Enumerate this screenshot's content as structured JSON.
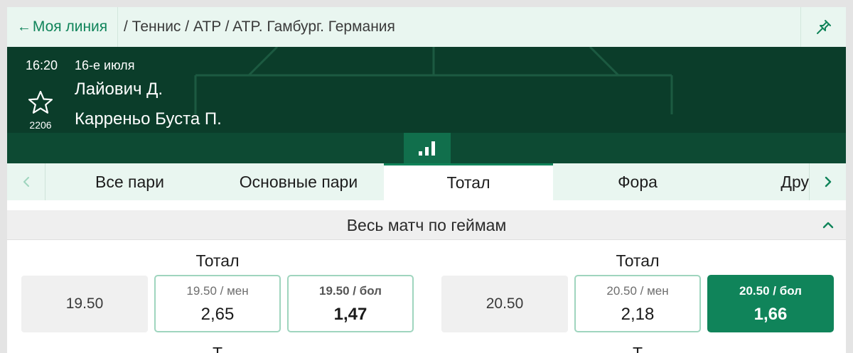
{
  "topbar": {
    "back_label": "Моя линия",
    "back_arrow": "←",
    "breadcrumb": "/ Теннис / ATP / ATP. Гамбург. Германия",
    "pin_icon": "pin-icon"
  },
  "event": {
    "time": "16:20",
    "date": "16-е июля",
    "team1": "Лайович Д.",
    "team2": "Карреньо Буста П.",
    "favorites_count": "2206",
    "star_icon": "star-outline-icon",
    "stats_icon": "bar-chart-icon"
  },
  "tabs": {
    "items": [
      "Все пари",
      "Основные пари",
      "Тотал",
      "Фора",
      "Дру"
    ],
    "active": "Тотал",
    "prev_icon": "chevron-left-icon",
    "next_icon": "chevron-right-icon"
  },
  "section": {
    "title": "Весь матч по геймам",
    "collapse_icon": "chevron-up-icon"
  },
  "markets": [
    {
      "title": "Тотал",
      "line": "19.50",
      "under": {
        "label": "19.50 / мен",
        "odds": "2,65"
      },
      "over": {
        "label": "19.50 / бол",
        "odds": "1,47"
      }
    },
    {
      "title": "Тотал",
      "line": "20.50",
      "under": {
        "label": "20.50 / мен",
        "odds": "2,18"
      },
      "over": {
        "label": "20.50 / бол",
        "odds": "1,66"
      }
    }
  ],
  "next_markets": {
    "left_title": "Т",
    "right_title": "Т"
  },
  "colors": {
    "brand_green": "#10845a",
    "header_dark": "#0b3d2a",
    "header_band": "#0d4a33",
    "tab_bg": "#e9f6f0"
  }
}
